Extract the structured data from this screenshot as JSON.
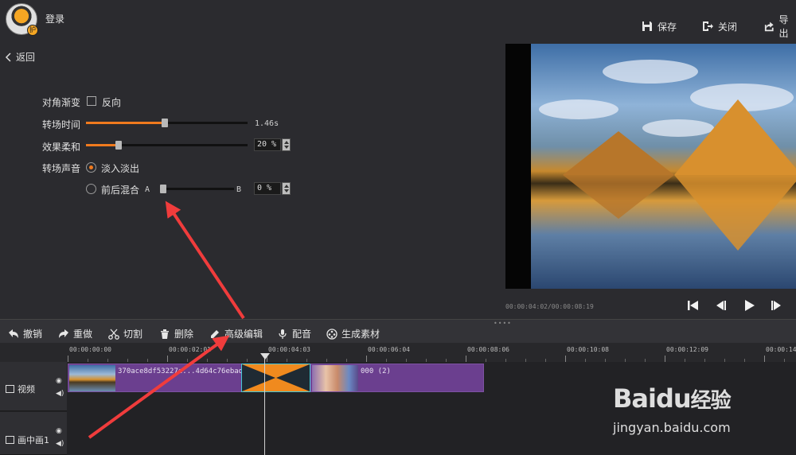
{
  "header": {
    "login_label": "登录",
    "save_label": "保存",
    "close_label": "关闭",
    "export_label": "导出"
  },
  "left_panel": {
    "back_label": "返回",
    "diagonal_label": "对角渐变",
    "reverse_label": "反向",
    "reverse_checked": false,
    "duration_label": "转场时间",
    "duration_value": "1.46s",
    "duration_fraction": 0.49,
    "softness_label": "效果柔和",
    "softness_value": "20 %",
    "softness_fraction": 0.2,
    "sound_label": "转场声音",
    "fade_label": "淡入淡出",
    "fade_selected": true,
    "mix_label": "前后混合",
    "mix_a": "A",
    "mix_b": "B",
    "mix_value": "0 %",
    "mix_fraction": 0.0
  },
  "preview": {
    "timecode": "00:00:04:02/00:00:08:19"
  },
  "toolbar": {
    "undo": "撤销",
    "redo": "重做",
    "cut": "切割",
    "delete": "删除",
    "advanced_edit": "高级编辑",
    "dub": "配音",
    "generate": "生成素材"
  },
  "ruler": {
    "labels": [
      "00:00:00:00",
      "00:00:02:01",
      "00:00:04:03",
      "00:00:06:04",
      "00:00:08:06",
      "00:00:10:08",
      "00:00:12:09",
      "00:00:14"
    ]
  },
  "tracks": {
    "video_label": "视频",
    "pip_label": "画中画1",
    "clip1_text": "370ace8df53227e...4d64c76ebad",
    "clip2_text": "000 (2)"
  },
  "watermark": {
    "brand": "Bai",
    "brand_cn": "经验",
    "url": "jingyan.baidu.com"
  },
  "colors": {
    "accent": "#f07a1e",
    "clip": "#6b3f8f",
    "transition_border": "#46c6d8",
    "annotation_arrow": "#f03c3c"
  }
}
